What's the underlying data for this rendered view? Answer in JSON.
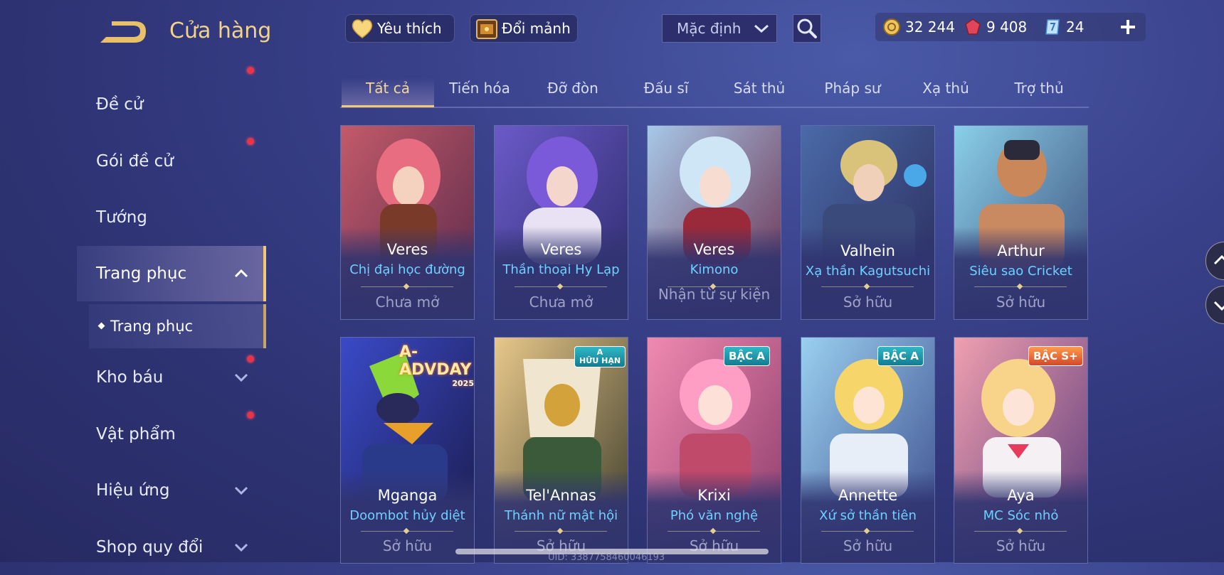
{
  "header": {
    "title": "Cửa hàng",
    "back_icon": "back-arrow-icon",
    "favorites_label": "Yêu thích",
    "exchange_label": "Đổi mảnh",
    "sort_value": "Mặc định",
    "search_icon": "search-icon"
  },
  "currencies": {
    "gold": "32 244",
    "gems": "9 408",
    "vouchers": "24"
  },
  "sidebar": {
    "items": [
      {
        "label": "Đề cử"
      },
      {
        "label": "Gói đề cử"
      },
      {
        "label": "Tướng"
      },
      {
        "label": "Trang phục"
      },
      {
        "label": "Kho báu"
      },
      {
        "label": "Vật phẩm"
      },
      {
        "label": "Hiệu ứng"
      },
      {
        "label": "Shop quy đổi"
      }
    ],
    "sub_item": "Trang phục"
  },
  "tabs": [
    "Tất cả",
    "Tiến hóa",
    "Đỡ đòn",
    "Đấu sĩ",
    "Sát thủ",
    "Pháp sư",
    "Xạ thủ",
    "Trợ thủ"
  ],
  "cards": [
    {
      "hero": "Veres",
      "skin": "Chị đại học đường",
      "status": "Chưa mở"
    },
    {
      "hero": "Veres",
      "skin": "Thần thoại Hy Lạp",
      "status": "Chưa mở"
    },
    {
      "hero": "Veres",
      "skin": "Kimono",
      "status": "Nhận từ sự kiện"
    },
    {
      "hero": "Valhein",
      "skin": "Xạ thần Kagutsuchi",
      "status": "Sở hữu"
    },
    {
      "hero": "Arthur",
      "skin": "Siêu sao Cricket",
      "status": "Sở hữu"
    },
    {
      "hero": "Mganga",
      "skin": "Doombot hủy diệt",
      "status": "Sở hữu",
      "overlay": "A-ADVDAY",
      "overlay_year": "2025"
    },
    {
      "hero": "Tel'Annas",
      "skin": "Thánh nữ mật hội",
      "status": "Sở hữu",
      "badge": "A",
      "badge_sub": "HỮU HẠN"
    },
    {
      "hero": "Krixi",
      "skin": "Phó văn nghệ",
      "status": "Sở hữu",
      "badge": "BẬC A"
    },
    {
      "hero": "Annette",
      "skin": "Xứ sở thần tiên",
      "status": "Sở hữu",
      "badge": "BẬC A"
    },
    {
      "hero": "Aya",
      "skin": "MC Sóc nhỏ",
      "status": "Sở hữu",
      "badge": "BẬC S+"
    }
  ],
  "footer": {
    "uid": "UID: 3387758460046193"
  },
  "colors": {
    "accent_gold": "#f1c977",
    "skin_name": "#6fd0ff",
    "background": "#39418a",
    "notification": "#e8344a"
  }
}
